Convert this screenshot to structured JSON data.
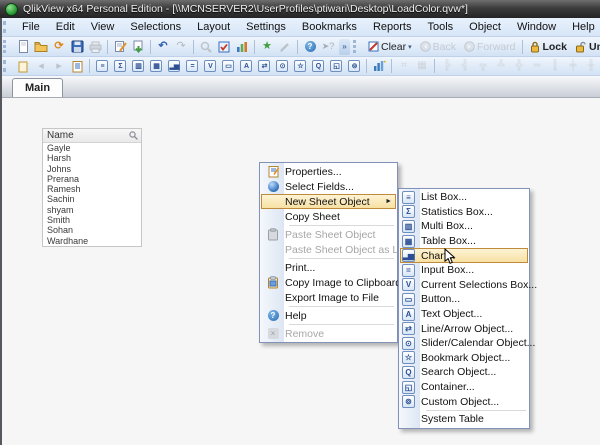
{
  "window": {
    "title": "QlikView x64 Personal Edition - [\\\\MCNSERVER2\\UserProfiles\\ptiwari\\Desktop\\LoadColor.qvw*]"
  },
  "menu_bar": {
    "items": [
      "File",
      "Edit",
      "View",
      "Selections",
      "Layout",
      "Settings",
      "Bookmarks",
      "Reports",
      "Tools",
      "Object",
      "Window",
      "Help"
    ]
  },
  "toolbar_nav": {
    "clear": "Clear",
    "back": "Back",
    "forward": "Forward",
    "lock": "Lock",
    "unlock": "Unlock"
  },
  "tab_bar": {
    "active_tab": "Main"
  },
  "list_box": {
    "header": "Name",
    "values": [
      "Gayle",
      "Harsh",
      "Johns",
      "Prerana",
      "Ramesh",
      "Sachin",
      "shyam",
      "Smith",
      "Sohan",
      "Wardhane"
    ]
  },
  "context_menu": {
    "items": {
      "properties": "Properties...",
      "select_fields": "Select Fields...",
      "new_sheet_object": "New Sheet Object",
      "copy_sheet": "Copy Sheet",
      "paste_sheet_object": "Paste Sheet Object",
      "paste_sheet_object_as_link": "Paste Sheet Object as Link",
      "print": "Print...",
      "copy_image_to_clipboard": "Copy Image to Clipboard",
      "export_image_to_file": "Export Image to File",
      "help": "Help",
      "remove": "Remove"
    }
  },
  "submenu": {
    "items": {
      "list_box": "List Box...",
      "statistics_box": "Statistics Box...",
      "multi_box": "Multi Box...",
      "table_box": "Table Box...",
      "chart": "Chart...",
      "input_box": "Input Box...",
      "current_selections_box": "Current Selections Box...",
      "button": "Button...",
      "text_object": "Text Object...",
      "line_arrow_object": "Line/Arrow Object...",
      "slider_calendar_object": "Slider/Calendar Object...",
      "bookmark_object": "Bookmark Object...",
      "search_object": "Search Object...",
      "container": "Container...",
      "custom_object": "Custom Object...",
      "system_table": "System Table"
    }
  },
  "icons": {
    "list_box": "≡",
    "statistics_box": "Σ",
    "multi_box": "▥",
    "table_box": "▦",
    "chart": "▂▅",
    "input_box": "=",
    "current_selections_box": "V",
    "button": "▭",
    "text_object": "A",
    "line_arrow_object": "⇄",
    "slider_calendar_object": "⊙",
    "bookmark_object": "☆",
    "search_object": "Q",
    "container": "◱",
    "custom_object": "⊚",
    "submenu_arrow": "►",
    "dropdown_arrow": "▾",
    "overflow": "»",
    "undo": "↶",
    "redo": "↷",
    "bookmark_star": "★",
    "question_mark": "?",
    "remove_x": "×",
    "alignment": [
      "╠",
      "╣",
      "╦",
      "╩",
      "╬",
      "═",
      "║",
      "╪",
      "╫",
      "▫"
    ]
  },
  "colors": {
    "menu_highlight_bg": "#F6DF9F",
    "menu_highlight_border": "#BE8B3D",
    "menu_border": "#8193B9",
    "toolbar_bg": "#D2E2F5",
    "titlebar_bg": "#3C3C3C",
    "app_green": "#2F9E3A"
  }
}
